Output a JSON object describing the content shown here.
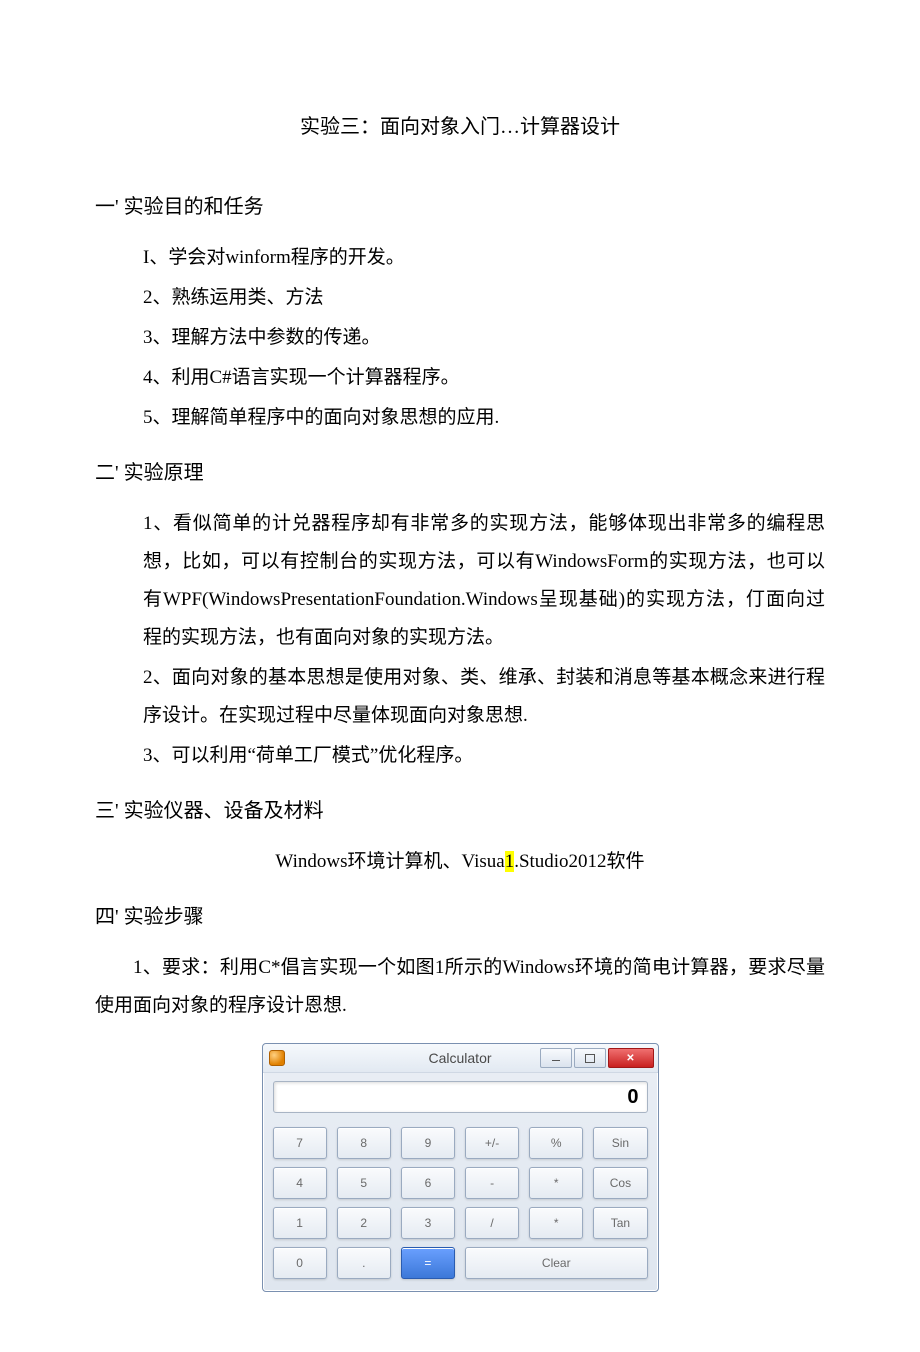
{
  "title": "实验三：面向对象入门…计算器设计",
  "sections": {
    "s1": {
      "heading": "一' 实验目的和任务",
      "items": [
        "I、学会对winform程序的开发。",
        "2、熟练运用类、方法",
        "3、理解方法中参数的传递。",
        "4、利用C#语言实现一个计算器程序。",
        "5、理解简单程序中的面向对象思想的应用."
      ]
    },
    "s2": {
      "heading": "二' 实验原理",
      "p1a": "1、看似简单的计兑器程序却有非常多的实现方法，能够体现出非常多的编程思想，比如，可以有控制台的实现方法，可以有WindowsForm的实现方法，也可以有WPF(WindowsPresentationFoundation.Windows呈现基础)的实现方法，仃面向过程的实现方法，也有面向对象的实现方法。",
      "p2": "2、面向对象的基本思想是使用对象、类、维承、封装和消息等基本概念来进行程序设计。在实现过程中尽量体现面向对象思想.",
      "p3": "3、可以利用“荷单工厂模式”优化程序。"
    },
    "s3": {
      "heading": "三' 实验仪器、设备及材料",
      "env_a": "Windows环境计算机、Visua",
      "env_hl": "1",
      "env_b": ".Studio2012软件"
    },
    "s4": {
      "heading": "四' 实验步骤",
      "p1": "1、要求：利用C*倡言实现一个如图1所示的Windows环境的简电计算器，要求尽量使用面向对象的程序设计恩想."
    }
  },
  "calculator": {
    "window_title": "Calculator",
    "display_value": "0",
    "keys": {
      "r1": [
        "7",
        "8",
        "9",
        "+/-",
        "%",
        "Sin"
      ],
      "r2": [
        "4",
        "5",
        "6",
        "-",
        "*",
        "Cos"
      ],
      "r3": [
        "1",
        "2",
        "3",
        "/",
        "*",
        "Tan"
      ],
      "r4": [
        "0",
        ".",
        "="
      ],
      "clear": "Clear"
    }
  }
}
